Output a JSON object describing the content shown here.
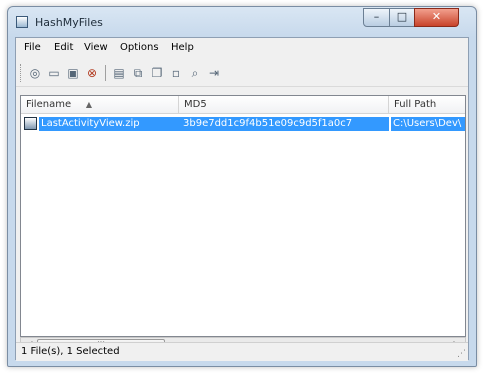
{
  "window": {
    "title": "HashMyFiles",
    "minimize_glyph": "–",
    "maximize_glyph": "□",
    "close_glyph": "✕"
  },
  "menu": [
    "File",
    "Edit",
    "View",
    "Options",
    "Help"
  ],
  "toolbar": {
    "icons": [
      "open-files-icon",
      "open-folder-icon",
      "open-folder-recursive-icon",
      "remove-icon",
      "save-icon",
      "copy-icon",
      "copy-hashes-icon",
      "properties-icon",
      "find-icon",
      "exit-icon"
    ]
  },
  "list": {
    "columns": [
      "Filename",
      "MD5",
      "Full Path"
    ],
    "rows": [
      {
        "filename": "LastActivityView.zip",
        "md5": "3b9e7dd1c9f4b51e09c9d5f1a0c7",
        "full_path": "C:\\Users\\Dev\\"
      }
    ],
    "scroll_thumb_glyph": "|||"
  },
  "status": {
    "text": "1 File(s), 1 Selected"
  }
}
